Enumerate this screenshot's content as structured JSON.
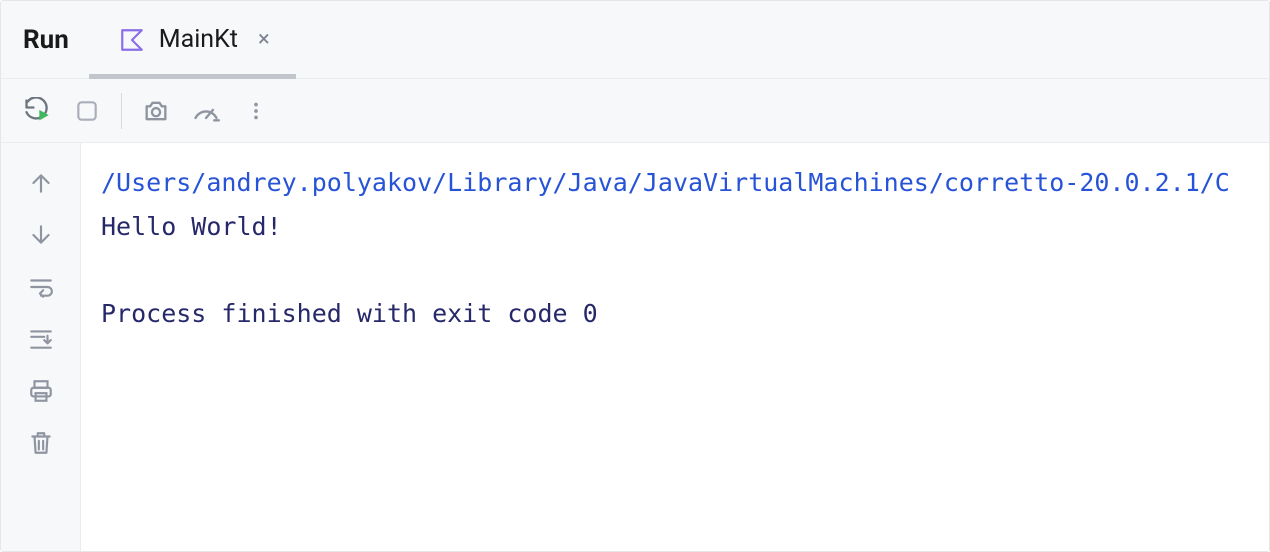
{
  "panel": {
    "title": "Run"
  },
  "tab": {
    "icon": "kotlin-icon",
    "label": "MainKt",
    "close": "×"
  },
  "toolbar": {
    "rerun": "rerun-icon",
    "stop": "stop-icon",
    "screenshot": "camera-icon",
    "performance": "gauge-icon",
    "more": "more-icon"
  },
  "gutter": {
    "scroll_up": "arrow-up-icon",
    "scroll_down": "arrow-down-icon",
    "soft_wrap": "soft-wrap-icon",
    "scroll_to_end": "scroll-end-icon",
    "print": "print-icon",
    "clear": "trash-icon"
  },
  "console": {
    "lines": {
      "cmd": "/Users/andrey.polyakov/Library/Java/JavaVirtualMachines/corretto-20.0.2.1/C",
      "out": "Hello World!",
      "blank": "",
      "status": "Process finished with exit code 0"
    }
  }
}
